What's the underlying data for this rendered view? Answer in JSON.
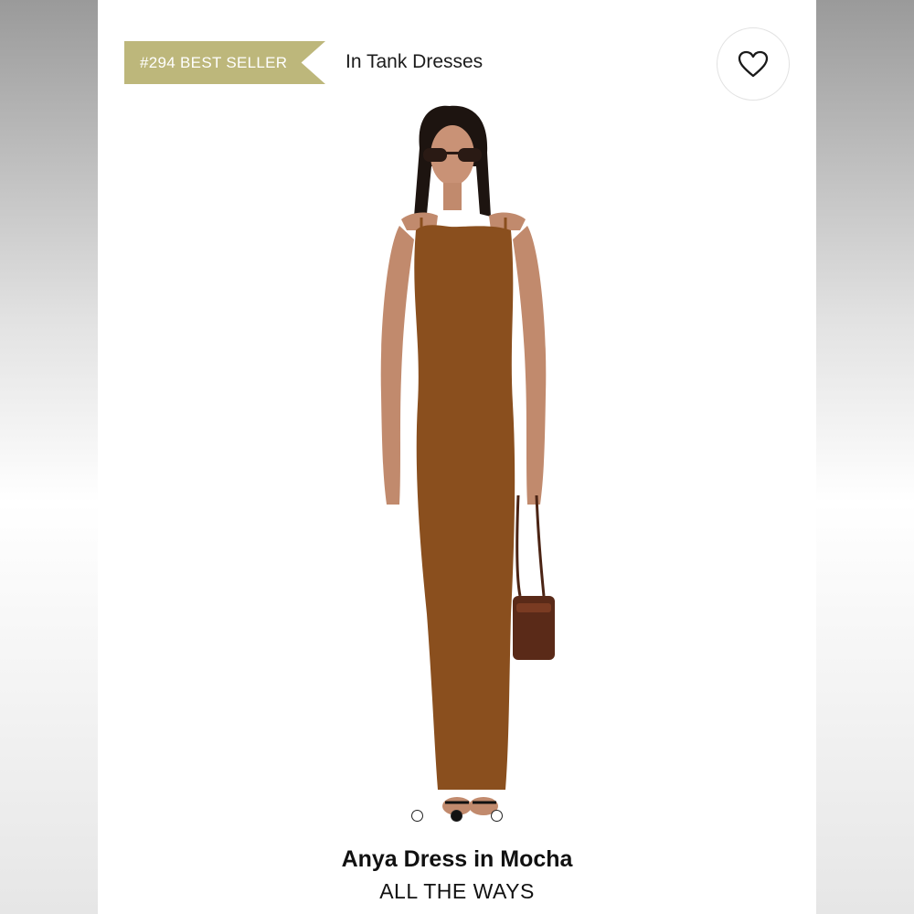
{
  "badge": {
    "label": "#294 BEST SELLER",
    "color": "#bdb77b"
  },
  "category": {
    "label": "In Tank Dresses"
  },
  "favorite": {
    "icon": "heart-outline-icon"
  },
  "carousel": {
    "total": 3,
    "active_index": 2
  },
  "product": {
    "name": "Anya Dress in Mocha",
    "brand": "ALL THE WAYS",
    "dress_color": "#8a4f1e"
  }
}
